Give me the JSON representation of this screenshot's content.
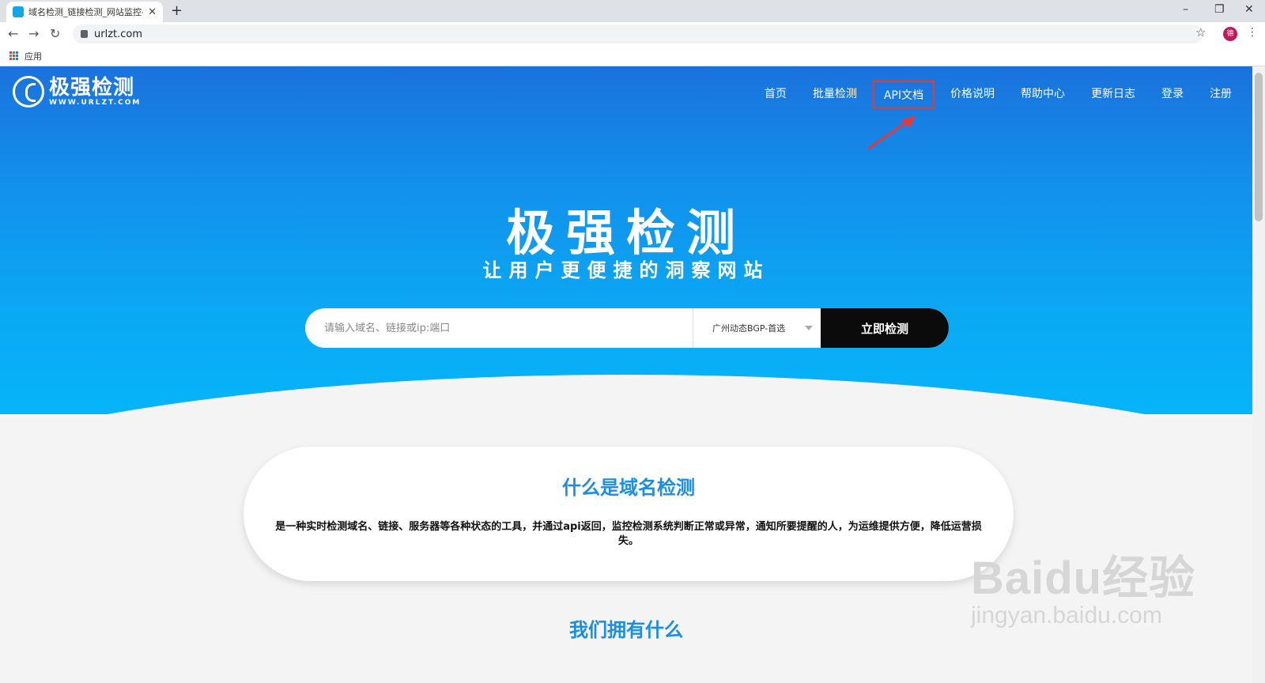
{
  "browser": {
    "tab_title": "域名检测_链接检测_网站监控-极",
    "url": "urlzt.com",
    "bookmark_apps": "应用",
    "profile_initial": "德"
  },
  "site": {
    "logo_name": "极强检测",
    "logo_url": "WWW.URLZT.COM",
    "nav": [
      "首页",
      "批量检测",
      "API文档",
      "价格说明",
      "帮助中心",
      "更新日志",
      "登录",
      "注册"
    ],
    "highlight_color": "#e53935"
  },
  "hero": {
    "title": "极强检测",
    "subtitle": "让用户更便捷的洞察网站",
    "search_placeholder": "请输入域名、链接或ip:端口",
    "node_select": "广州动态BGP-首选",
    "search_button": "立即检测"
  },
  "intro": {
    "title": "什么是域名检测",
    "description": "是一种实时检测域名、链接、服务器等各种状态的工具，并通过api返回，监控检测系统判断正常或异常，通知所要提醒的人，为运维提供方便，降低运营损失。"
  },
  "section2": {
    "title": "我们拥有什么"
  },
  "watermark": {
    "logo": "Baidu经验",
    "url": "jingyan.baidu.com"
  }
}
